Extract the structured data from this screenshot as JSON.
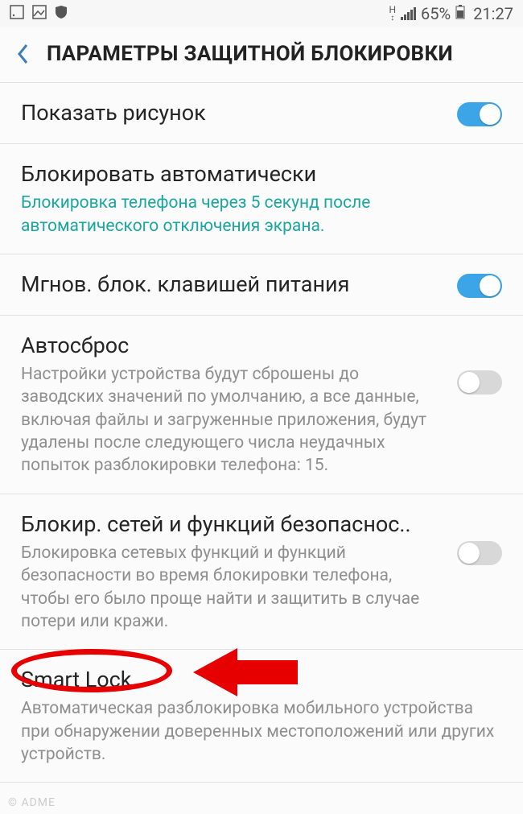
{
  "status": {
    "network_label": "H",
    "battery_pct": "65%",
    "time": "21:27"
  },
  "header": {
    "title": "ПАРАМЕТРЫ ЗАЩИТНОЙ БЛОКИРОВКИ"
  },
  "rows": {
    "show_pattern": {
      "title": "Показать рисунок",
      "on": true
    },
    "auto_lock": {
      "title": "Блокировать автоматически",
      "desc": "Блокировка телефона через 5 секунд после автоматического отключения экрана."
    },
    "instant_lock": {
      "title": "Мгнов. блок. клавишей питания",
      "on": true
    },
    "auto_reset": {
      "title": "Автосброс",
      "desc": "Настройки устройства будут сброшены до заводских значений по умолчанию, а все данные, включая файлы и загруженные приложения, будут удалены после следующего числа неудачных попыток разблокировки телефона: 15.",
      "on": false
    },
    "net_lock": {
      "title": "Блокир. сетей и функций безопаснос..",
      "desc": "Блокировка сетевых функций и функций безопасности во время блокировки телефона, чтобы его было проще найти и защитить в случае потери или кражи.",
      "on": false
    },
    "smart_lock": {
      "title": "Smart Lock",
      "desc": "Автоматическая разблокировка мобильного устройства при обнаружении доверенных местоположений или других устройств."
    }
  },
  "watermark": "© ADME"
}
